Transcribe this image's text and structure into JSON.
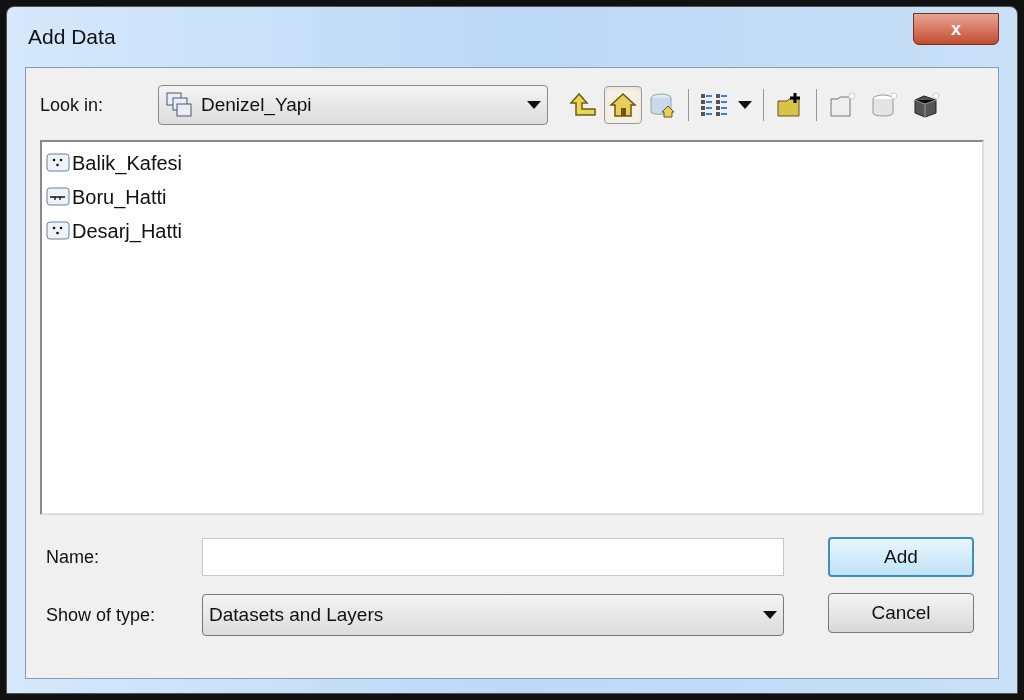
{
  "window": {
    "title": "Add Data",
    "close_label": "x"
  },
  "look_in": {
    "label": "Look in:",
    "value": "Denizel_Yapi"
  },
  "toolbar": [
    {
      "kind": "up",
      "selected": false
    },
    {
      "kind": "home",
      "selected": true
    },
    {
      "kind": "dbhome",
      "selected": false
    },
    {
      "kind": "sep"
    },
    {
      "kind": "view",
      "selected": false
    },
    {
      "kind": "sep"
    },
    {
      "kind": "connect",
      "selected": false
    },
    {
      "kind": "sep"
    },
    {
      "kind": "newfolder",
      "selected": false
    },
    {
      "kind": "newdb",
      "selected": false
    },
    {
      "kind": "newtoolbox",
      "selected": false
    }
  ],
  "items": [
    {
      "name": "Balik_Kafesi",
      "kind": "point"
    },
    {
      "name": "Boru_Hatti",
      "kind": "line"
    },
    {
      "name": "Desarj_Hatti",
      "kind": "point"
    }
  ],
  "name_field": {
    "label": "Name:"
  },
  "type_field": {
    "label": "Show of type:",
    "value": "Datasets and Layers"
  },
  "buttons": [
    {
      "label": "Add",
      "default": true
    },
    {
      "label": "Cancel",
      "default": false
    }
  ]
}
